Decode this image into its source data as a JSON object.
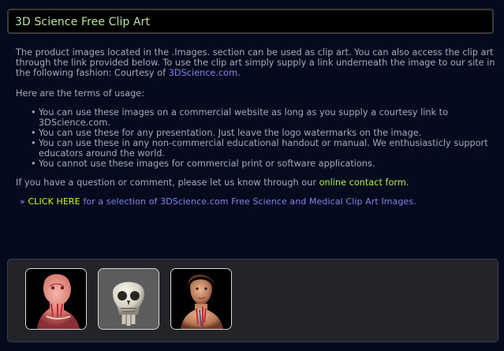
{
  "header": {
    "title": "3D Science Free Clip Art"
  },
  "intro": {
    "text_1": "The product images located in the .Images. section can be used as clip art. You can also access the clip art through the link provided below. To use the clip art simply supply a link underneath the image to our site in the following fashion: Courtesy of ",
    "link": "3DScience.com",
    "text_2": "."
  },
  "terms": {
    "heading": "Here are the terms of usage:",
    "bullet": "•",
    "items": [
      "You can use these images on a commercial website as long as you supply a courtesy link to 3DScience.com.",
      "You can use these for any presentation. Just leave the logo watermarks on the image.",
      "You can use these in any non-commercial educational handout or manual. We enthusiasticly support educators around the world.",
      "You cannot use these images for commercial print or software applications."
    ]
  },
  "question": {
    "text": "If you have a question or comment, please let us know through our ",
    "link": "online contact form",
    "suffix": "."
  },
  "clickline": {
    "arrow": "»",
    "click_here": "CLICK HERE",
    "rest": " for a selection of 3DScience.com Free Science and Medical Clip Art Images."
  },
  "gallery": {
    "thumbnails": [
      "head-anatomy-thumbnail",
      "skull-thumbnail",
      "face-anatomy-thumbnail"
    ]
  },
  "colors": {
    "background": "#050b1d",
    "header_text": "#b8e0a0",
    "body_text": "#a4abb8",
    "link_blue": "#7a86ee",
    "link_green": "#a9ef50",
    "click_here": "#c6ff00"
  }
}
